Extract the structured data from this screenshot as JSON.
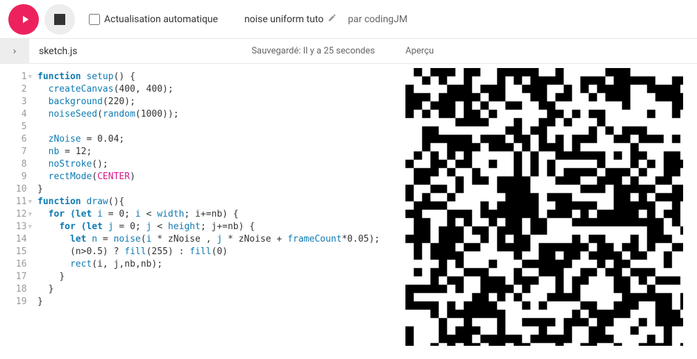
{
  "toolbar": {
    "auto_refresh_label": "Actualisation automatique",
    "sketch_title": "noise uniform tuto",
    "by_prefix": "par",
    "author": "codingJM"
  },
  "subbar": {
    "filename": "sketch.js",
    "saved_text": "Sauvegardé: Il y a 25 secondes",
    "preview_label": "Aperçu"
  },
  "code_lines": [
    {
      "n": 1,
      "fold": true
    },
    {
      "n": 2
    },
    {
      "n": 3
    },
    {
      "n": 4
    },
    {
      "n": 5
    },
    {
      "n": 6
    },
    {
      "n": 7
    },
    {
      "n": 8
    },
    {
      "n": 9
    },
    {
      "n": 10
    },
    {
      "n": 11,
      "fold": true
    },
    {
      "n": 12,
      "fold": true
    },
    {
      "n": 13,
      "fold": true
    },
    {
      "n": 14
    },
    {
      "n": 15
    },
    {
      "n": 16
    },
    {
      "n": 17
    },
    {
      "n": 18
    },
    {
      "n": 19
    }
  ],
  "code": {
    "l1_function": "function ",
    "l1_setup": "setup",
    "l1_rest": "() {",
    "l2_fn": "createCanvas",
    "l2_args": "(400, 400);",
    "l3_fn": "background",
    "l3_args": "(220);",
    "l4_fn": "noiseSeed",
    "l4_open": "(",
    "l4_random": "random",
    "l4_args": "(1000));",
    "l6_var": "zNoise",
    "l6_rest": " = 0.04;",
    "l7_var": "nb",
    "l7_rest": " = 12;",
    "l8_fn": "noStroke",
    "l8_args": "();",
    "l9_fn": "rectMode",
    "l9_open": "(",
    "l9_const": "CENTER",
    "l9_close": ")",
    "l10": "}",
    "l11_function": "function ",
    "l11_draw": "draw",
    "l11_rest": "(){",
    "l12_for": "for ",
    "l12_let": "(let ",
    "l12_i": "i",
    "l12_eq": " = 0; ",
    "l12_i2": "i",
    "l12_lt": " < ",
    "l12_width": "width",
    "l12_rest": "; i+=nb) {",
    "l13_for": "for ",
    "l13_let": "(let ",
    "l13_j": "j",
    "l13_eq": " = 0; ",
    "l13_j2": "j",
    "l13_lt": " < ",
    "l13_height": "height",
    "l13_rest": "; j+=nb) {",
    "l14_let": "let ",
    "l14_n": "n",
    "l14_eq": " = ",
    "l14_noise": "noise",
    "l14_open": "(",
    "l14_i": "i",
    "l14_mul1": " * zNoise , ",
    "l14_j": "j",
    "l14_mul2": " * zNoise + ",
    "l14_fc": "frameCount",
    "l14_rest": "*0.05);",
    "l15_cond": "(n>0.5) ? ",
    "l15_fill1": "fill",
    "l15_a1": "(255) : ",
    "l15_fill2": "fill",
    "l15_a2": "(0)",
    "l16_rect": "rect",
    "l16_args": "(i, j,nb,nb);",
    "l17": "}",
    "l18": "}",
    "l19": "}"
  },
  "noise": {
    "size": 400,
    "nb": 12,
    "zNoise": 0.04
  }
}
